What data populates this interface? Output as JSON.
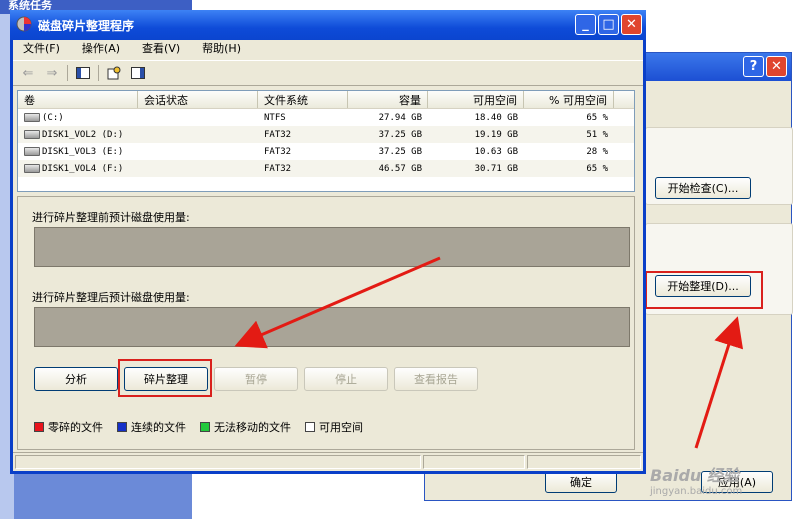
{
  "desktop": {
    "task_label": "系统任务"
  },
  "window": {
    "title": "磁盘碎片整理程序"
  },
  "menu": [
    "文件(F)",
    "操作(A)",
    "查看(V)",
    "帮助(H)"
  ],
  "table": {
    "headers": [
      "卷",
      "会话状态",
      "文件系统",
      "容量",
      "可用空间",
      "% 可用空间"
    ],
    "rows": [
      {
        "vol": "(C:)",
        "status": "",
        "fs": "NTFS",
        "cap": "27.94 GB",
        "free": "18.40 GB",
        "pct": "65 %"
      },
      {
        "vol": "DISK1_VOL2 (D:)",
        "status": "",
        "fs": "FAT32",
        "cap": "37.25 GB",
        "free": "19.19 GB",
        "pct": "51 %"
      },
      {
        "vol": "DISK1_VOL3 (E:)",
        "status": "",
        "fs": "FAT32",
        "cap": "37.25 GB",
        "free": "10.63 GB",
        "pct": "28 %"
      },
      {
        "vol": "DISK1_VOL4 (F:)",
        "status": "",
        "fs": "FAT32",
        "cap": "46.57 GB",
        "free": "30.71 GB",
        "pct": "65 %"
      }
    ]
  },
  "panel": {
    "before_label": "进行碎片整理前预计磁盘使用量:",
    "after_label": "进行碎片整理后预计磁盘使用量:",
    "buttons": {
      "analyze": "分析",
      "defrag": "碎片整理",
      "pause": "暂停",
      "stop": "停止",
      "report": "查看报告"
    },
    "legend": [
      {
        "label": "零碎的文件",
        "color": "#e8141c"
      },
      {
        "label": "连续的文件",
        "color": "#1530c8"
      },
      {
        "label": "无法移动的文件",
        "color": "#22c93c"
      },
      {
        "label": "可用空间",
        "color": "#ffffff"
      }
    ]
  },
  "props_dialog": {
    "check_button": "开始检查(C)...",
    "defrag_button": "开始整理(D)...",
    "ok_button": "确定",
    "apply_button": "应用(A)"
  },
  "watermark": "Baidu 经验",
  "watermark_url": "jingyan.baidu.com",
  "colors": {
    "highlight": "#d9211d",
    "titlebar": "#0e4bd8"
  }
}
